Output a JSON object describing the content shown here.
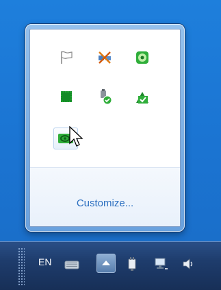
{
  "flyout": {
    "customize_label": "Customize...",
    "icons": [
      {
        "name": "action-center-flag-icon"
      },
      {
        "name": "network-disconnected-icon"
      },
      {
        "name": "green-disc-app-icon"
      },
      {
        "name": "green-chip-app-icon"
      },
      {
        "name": "usb-safely-remove-icon"
      },
      {
        "name": "green-update-app-icon"
      },
      {
        "name": "nvidia-settings-icon"
      }
    ]
  },
  "taskbar": {
    "language_label": "EN",
    "icons": [
      "keyboard-icon",
      "show-hidden-icons-button",
      "power-icon",
      "network-icon",
      "volume-icon"
    ]
  },
  "colors": {
    "desktop_blue": "#1b75d3",
    "link_blue": "#2c6fc0",
    "icon_green": "#2fae3a",
    "taskbar_dark": "#1e3c6c"
  }
}
